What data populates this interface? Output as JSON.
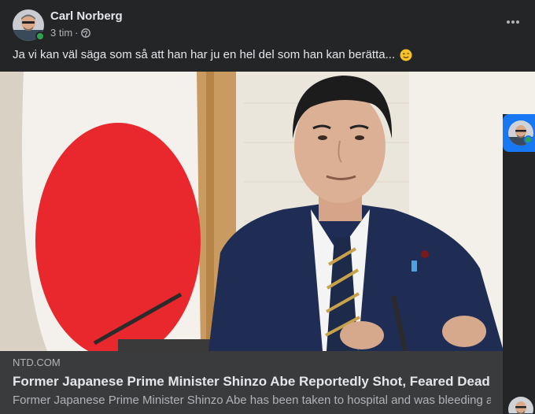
{
  "post": {
    "author": "Carl Norberg",
    "time": "3 tim",
    "separator": "·",
    "privacy_icon": "globe-icon",
    "menu_icon": "more-horizontal-icon",
    "text": "Ja vi kan väl säga som så att han har ju en hel del som han kan berätta...",
    "emoji": "winking-face-icon"
  },
  "link_preview": {
    "source": "NTD.COM",
    "headline": "Former Japanese Prime Minister Shinzo Abe Reportedly Shot, Feared Dead",
    "description": "Former Japanese Prime Minister Shinzo Abe has been taken to hospital and was bleeding aft..."
  },
  "colors": {
    "card_bg": "#242526",
    "preview_bg": "#3a3b3c",
    "primary_text": "#e4e6eb",
    "secondary_text": "#b0b3b8",
    "online": "#31a24c",
    "accent": "#1877f2"
  }
}
